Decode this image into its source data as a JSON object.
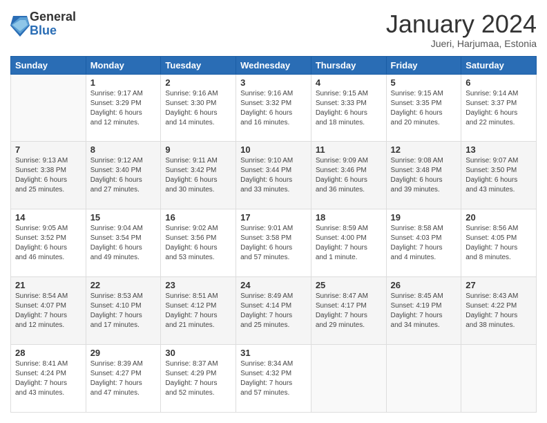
{
  "logo": {
    "general": "General",
    "blue": "Blue"
  },
  "header": {
    "month": "January 2024",
    "location": "Jueri, Harjumaa, Estonia"
  },
  "weekdays": [
    "Sunday",
    "Monday",
    "Tuesday",
    "Wednesday",
    "Thursday",
    "Friday",
    "Saturday"
  ],
  "weeks": [
    [
      {
        "day": "",
        "info": ""
      },
      {
        "day": "1",
        "info": "Sunrise: 9:17 AM\nSunset: 3:29 PM\nDaylight: 6 hours\nand 12 minutes."
      },
      {
        "day": "2",
        "info": "Sunrise: 9:16 AM\nSunset: 3:30 PM\nDaylight: 6 hours\nand 14 minutes."
      },
      {
        "day": "3",
        "info": "Sunrise: 9:16 AM\nSunset: 3:32 PM\nDaylight: 6 hours\nand 16 minutes."
      },
      {
        "day": "4",
        "info": "Sunrise: 9:15 AM\nSunset: 3:33 PM\nDaylight: 6 hours\nand 18 minutes."
      },
      {
        "day": "5",
        "info": "Sunrise: 9:15 AM\nSunset: 3:35 PM\nDaylight: 6 hours\nand 20 minutes."
      },
      {
        "day": "6",
        "info": "Sunrise: 9:14 AM\nSunset: 3:37 PM\nDaylight: 6 hours\nand 22 minutes."
      }
    ],
    [
      {
        "day": "7",
        "info": "Sunrise: 9:13 AM\nSunset: 3:38 PM\nDaylight: 6 hours\nand 25 minutes."
      },
      {
        "day": "8",
        "info": "Sunrise: 9:12 AM\nSunset: 3:40 PM\nDaylight: 6 hours\nand 27 minutes."
      },
      {
        "day": "9",
        "info": "Sunrise: 9:11 AM\nSunset: 3:42 PM\nDaylight: 6 hours\nand 30 minutes."
      },
      {
        "day": "10",
        "info": "Sunrise: 9:10 AM\nSunset: 3:44 PM\nDaylight: 6 hours\nand 33 minutes."
      },
      {
        "day": "11",
        "info": "Sunrise: 9:09 AM\nSunset: 3:46 PM\nDaylight: 6 hours\nand 36 minutes."
      },
      {
        "day": "12",
        "info": "Sunrise: 9:08 AM\nSunset: 3:48 PM\nDaylight: 6 hours\nand 39 minutes."
      },
      {
        "day": "13",
        "info": "Sunrise: 9:07 AM\nSunset: 3:50 PM\nDaylight: 6 hours\nand 43 minutes."
      }
    ],
    [
      {
        "day": "14",
        "info": "Sunrise: 9:05 AM\nSunset: 3:52 PM\nDaylight: 6 hours\nand 46 minutes."
      },
      {
        "day": "15",
        "info": "Sunrise: 9:04 AM\nSunset: 3:54 PM\nDaylight: 6 hours\nand 49 minutes."
      },
      {
        "day": "16",
        "info": "Sunrise: 9:02 AM\nSunset: 3:56 PM\nDaylight: 6 hours\nand 53 minutes."
      },
      {
        "day": "17",
        "info": "Sunrise: 9:01 AM\nSunset: 3:58 PM\nDaylight: 6 hours\nand 57 minutes."
      },
      {
        "day": "18",
        "info": "Sunrise: 8:59 AM\nSunset: 4:00 PM\nDaylight: 7 hours\nand 1 minute."
      },
      {
        "day": "19",
        "info": "Sunrise: 8:58 AM\nSunset: 4:03 PM\nDaylight: 7 hours\nand 4 minutes."
      },
      {
        "day": "20",
        "info": "Sunrise: 8:56 AM\nSunset: 4:05 PM\nDaylight: 7 hours\nand 8 minutes."
      }
    ],
    [
      {
        "day": "21",
        "info": "Sunrise: 8:54 AM\nSunset: 4:07 PM\nDaylight: 7 hours\nand 12 minutes."
      },
      {
        "day": "22",
        "info": "Sunrise: 8:53 AM\nSunset: 4:10 PM\nDaylight: 7 hours\nand 17 minutes."
      },
      {
        "day": "23",
        "info": "Sunrise: 8:51 AM\nSunset: 4:12 PM\nDaylight: 7 hours\nand 21 minutes."
      },
      {
        "day": "24",
        "info": "Sunrise: 8:49 AM\nSunset: 4:14 PM\nDaylight: 7 hours\nand 25 minutes."
      },
      {
        "day": "25",
        "info": "Sunrise: 8:47 AM\nSunset: 4:17 PM\nDaylight: 7 hours\nand 29 minutes."
      },
      {
        "day": "26",
        "info": "Sunrise: 8:45 AM\nSunset: 4:19 PM\nDaylight: 7 hours\nand 34 minutes."
      },
      {
        "day": "27",
        "info": "Sunrise: 8:43 AM\nSunset: 4:22 PM\nDaylight: 7 hours\nand 38 minutes."
      }
    ],
    [
      {
        "day": "28",
        "info": "Sunrise: 8:41 AM\nSunset: 4:24 PM\nDaylight: 7 hours\nand 43 minutes."
      },
      {
        "day": "29",
        "info": "Sunrise: 8:39 AM\nSunset: 4:27 PM\nDaylight: 7 hours\nand 47 minutes."
      },
      {
        "day": "30",
        "info": "Sunrise: 8:37 AM\nSunset: 4:29 PM\nDaylight: 7 hours\nand 52 minutes."
      },
      {
        "day": "31",
        "info": "Sunrise: 8:34 AM\nSunset: 4:32 PM\nDaylight: 7 hours\nand 57 minutes."
      },
      {
        "day": "",
        "info": ""
      },
      {
        "day": "",
        "info": ""
      },
      {
        "day": "",
        "info": ""
      }
    ]
  ]
}
